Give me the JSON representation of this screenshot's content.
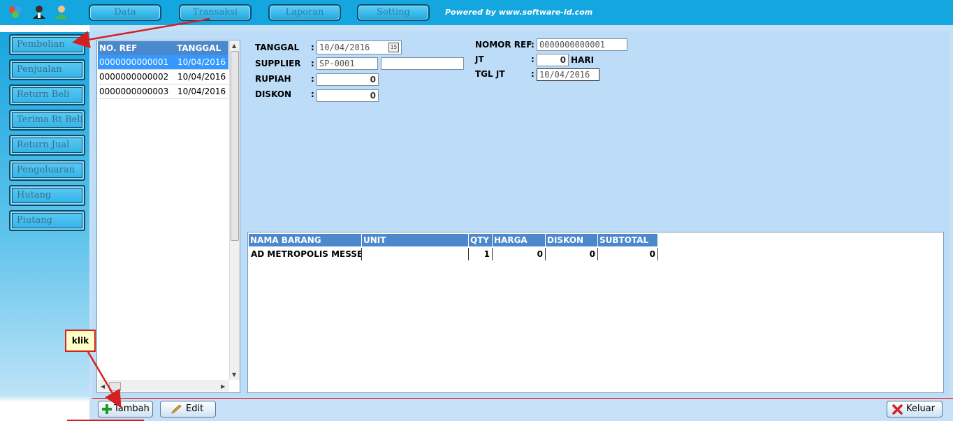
{
  "topbar": {
    "menus": [
      "Data",
      "Transaksi",
      "Laporan",
      "Setting"
    ],
    "powered": "Powered by www.software-id.com",
    "bg_color": "#13a6df"
  },
  "sidebar": {
    "items": [
      "Pembelian",
      "Penjualan",
      "Return Beli",
      "Terima Rt Beli",
      "Return Jual",
      "Pengeluaran",
      "Hutang",
      "Piutang"
    ]
  },
  "list": {
    "headers": [
      "NO. REF",
      "TANGGAL"
    ],
    "rows": [
      {
        "ref": "0000000000001",
        "date": "10/04/2016",
        "selected": true
      },
      {
        "ref": "0000000000002",
        "date": "10/04/2016",
        "selected": false
      },
      {
        "ref": "0000000000003",
        "date": "10/04/2016",
        "selected": false
      }
    ]
  },
  "form": {
    "tanggal_label": "TANGGAL",
    "tanggal_value": "10/04/2016",
    "calendar_glyph": "15",
    "supplier_label": "SUPPLIER",
    "supplier_code": "SP-0001",
    "supplier_name": "",
    "rupiah_label": "RUPIAH",
    "rupiah_value": "0",
    "diskon_label": "DISKON",
    "diskon_value": "0",
    "nomor_ref_label": "NOMOR REF",
    "nomor_ref_value": "0000000000001",
    "jt_label": "JT",
    "jt_value": "0",
    "jt_unit": "HARI",
    "tgl_jt_label": "TGL JT",
    "tgl_jt_value": "10/04/2016",
    "colon": ":"
  },
  "grid": {
    "headers": [
      "NAMA BARANG",
      "UNIT",
      "QTY",
      "HARGA",
      "DISKON",
      "SUBTOTAL"
    ],
    "rows": [
      {
        "nama": "AD METROPOLIS MESSENG",
        "unit": "",
        "qty": "1",
        "harga": "0",
        "diskon": "0",
        "subtotal": "0"
      }
    ]
  },
  "buttons": {
    "tambah": "Tambah",
    "edit": "Edit",
    "keluar": "Keluar"
  },
  "annotation": {
    "klik": "klik"
  }
}
